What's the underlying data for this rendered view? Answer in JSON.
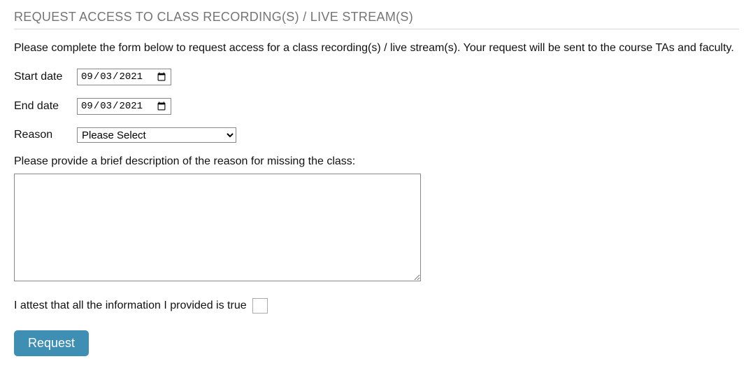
{
  "section_title": "REQUEST ACCESS TO CLASS RECORDING(S) / LIVE STREAM(S)",
  "intro_text": "Please complete the form below to request access for a class recording(s) / live stream(s). Your request will be sent to the course TAs and faculty.",
  "labels": {
    "start_date": "Start date",
    "end_date": "End date",
    "reason": "Reason",
    "description": "Please provide a brief description of the reason for missing the class:",
    "attestation": "I attest that all the information I provided is true"
  },
  "values": {
    "start_date": "2021-09-03",
    "end_date": "2021-09-03",
    "reason_selected": "Please Select",
    "description": ""
  },
  "buttons": {
    "submit": "Request"
  }
}
